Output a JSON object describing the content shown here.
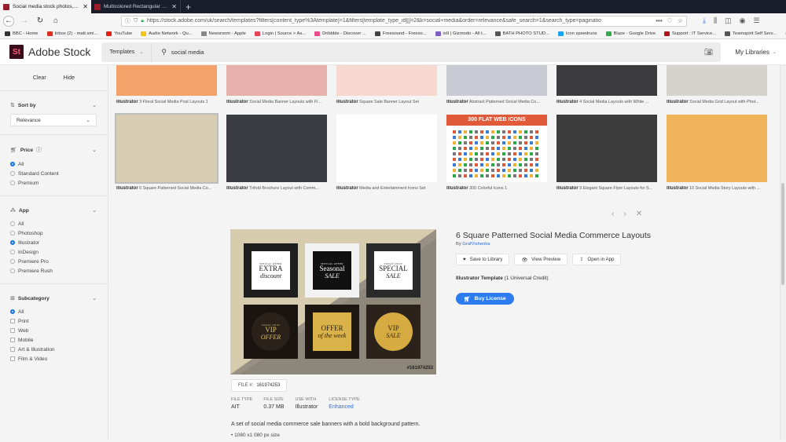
{
  "browser": {
    "tabs": [
      {
        "title": "Social media stock photos, roy",
        "active": true
      },
      {
        "title": "Multicolored Rectangular Soci",
        "active": false
      }
    ],
    "url": "https://stock.adobe.com/uk/search/templates?filters[content_type%3Atemplate]=1&filters[template_type_id][]=2&k=social+media&order=relevance&safe_search=1&search_type=paginatio",
    "url_overflow": "•••",
    "bookmarks": [
      {
        "label": "BBC - Home",
        "color": "#333333"
      },
      {
        "label": "Inbox (2) - matt.smi...",
        "color": "#d93025"
      },
      {
        "label": "YouTube",
        "color": "#e62117"
      },
      {
        "label": "Audio Network - Qu...",
        "color": "#f0c419"
      },
      {
        "label": "Newsroom - Apple",
        "color": "#888888"
      },
      {
        "label": "Login | Source > As...",
        "color": "#e8455a"
      },
      {
        "label": "Dribbble - Discover ...",
        "color": "#ea4c89"
      },
      {
        "label": "Freesound - Freeso...",
        "color": "#444444"
      },
      {
        "label": "io9 | Gizmodo - All t...",
        "color": "#7b5fc7"
      },
      {
        "label": "BATH PHOTO STUD...",
        "color": "#555555"
      },
      {
        "label": "Icon speedruns",
        "color": "#1da1f2"
      },
      {
        "label": "Blaze - Google Drive",
        "color": "#34a853"
      },
      {
        "label": "Support : IT Service...",
        "color": "#b3121f"
      },
      {
        "label": "Teamspirit Self Serv...",
        "color": "#555555"
      }
    ],
    "bookmarks_more": "»"
  },
  "header": {
    "logo": "St",
    "brand": "Adobe Stock",
    "search_type": "Templates",
    "search_query": "social media",
    "my_libraries": "My Libraries"
  },
  "sidebar": {
    "clear": "Clear",
    "hide": "Hide",
    "sort": {
      "title": "Sort by",
      "value": "Relevance"
    },
    "price": {
      "title": "Price",
      "options": [
        {
          "label": "All",
          "selected": true
        },
        {
          "label": "Standard Content",
          "selected": false
        },
        {
          "label": "Premium",
          "selected": false
        }
      ]
    },
    "app": {
      "title": "App",
      "options": [
        {
          "label": "All",
          "selected": false
        },
        {
          "label": "Photoshop",
          "selected": false
        },
        {
          "label": "Illustrator",
          "selected": true
        },
        {
          "label": "InDesign",
          "selected": false
        },
        {
          "label": "Premiere Pro",
          "selected": false
        },
        {
          "label": "Premiere Rush",
          "selected": false
        }
      ]
    },
    "subcategory": {
      "title": "Subcategory",
      "options": [
        {
          "label": "All",
          "selected": true
        },
        {
          "label": "Print",
          "selected": false
        },
        {
          "label": "Web",
          "selected": false
        },
        {
          "label": "Mobile",
          "selected": false
        },
        {
          "label": "Art & Illustration",
          "selected": false
        },
        {
          "label": "Film & Video",
          "selected": false
        }
      ]
    }
  },
  "results": {
    "row1": [
      {
        "app": "Illustrator",
        "title": "3 Floral Social Media Post Layouts 1",
        "bg": "#f3a26a"
      },
      {
        "app": "Illustrator",
        "title": "Social Media Banner Layouts with Fl...",
        "bg": "#e8b0ac"
      },
      {
        "app": "Illustrator",
        "title": "Square Sale Banner Layout Set",
        "bg": "#f6d8cf"
      },
      {
        "app": "Illustrator",
        "title": "Abstract Patterned Social Media Co...",
        "bg": "#c9cbd4"
      },
      {
        "app": "Illustrator",
        "title": "4 Social Media Layouts with White ...",
        "bg": "#3b3b3e"
      },
      {
        "app": "Illustrator",
        "title": "Social Media Grid Layout with Phot...",
        "bg": "#d6d3cc"
      }
    ],
    "row2": [
      {
        "app": "Illustrator",
        "title": "6 Square Patterned Social Media Co...",
        "bg": "#d8cdb2"
      },
      {
        "app": "Illustrator",
        "title": "Trifold Brochure Layout with Comm...",
        "bg": "#3a3c42"
      },
      {
        "app": "Illustrator",
        "title": "Media and Entertainment Icons Set",
        "bg": "#ffffff"
      },
      {
        "app": "Illustrator",
        "title": "300 Colorful Icons 1",
        "bg": "#ffffff",
        "banner": "300 FLAT WEB ICONS"
      },
      {
        "app": "Illustrator",
        "title": "9 Elegant Square Flyer Layouts for S...",
        "bg": "#3c3c3c"
      },
      {
        "app": "Illustrator",
        "title": "10 Social Media Story Layouts with ...",
        "bg": "#f0b45a"
      }
    ]
  },
  "detail": {
    "title": "6 Square Patterned Social Media Commerce Layouts",
    "by_label": "By",
    "author": "GrafVishenka",
    "actions": [
      "Save to Library",
      "View Preview",
      "Open in App"
    ],
    "license_bold": "Illustrator Template",
    "license_rest": "(1 Universal Credit)",
    "buy": "Buy License",
    "file_label": "FILE #:",
    "file_number": "161974253",
    "watermark": "#161974253",
    "meta": [
      {
        "key": "FILE TYPE",
        "value": "AIT"
      },
      {
        "key": "FILE SIZE",
        "value": "0.37 MB"
      },
      {
        "key": "USE WITH",
        "value": "Illustrator"
      },
      {
        "key": "LICENSE TYPE",
        "value": "Enhanced",
        "link": true
      }
    ],
    "description": "A set of social media commerce sale banners with a bold background pattern.",
    "bullet": "1080 x1 080 px size",
    "tiles": [
      {
        "top": "SPECIAL OFFER",
        "main": "EXTRA",
        "sub": "discount"
      },
      {
        "top": "SPECIAL OFFER",
        "main": "Seasonal",
        "sub": "SALE"
      },
      {
        "top": "TODAY ONLY",
        "main": "SPECIAL",
        "sub": "SALE"
      },
      {
        "top": "TODAY ONLY",
        "main": "VIP",
        "sub": "OFFER"
      },
      {
        "top": "",
        "main": "OFFER",
        "sub": "of the week"
      },
      {
        "top": "",
        "main": "VIP",
        "sub": "SALE"
      }
    ]
  }
}
